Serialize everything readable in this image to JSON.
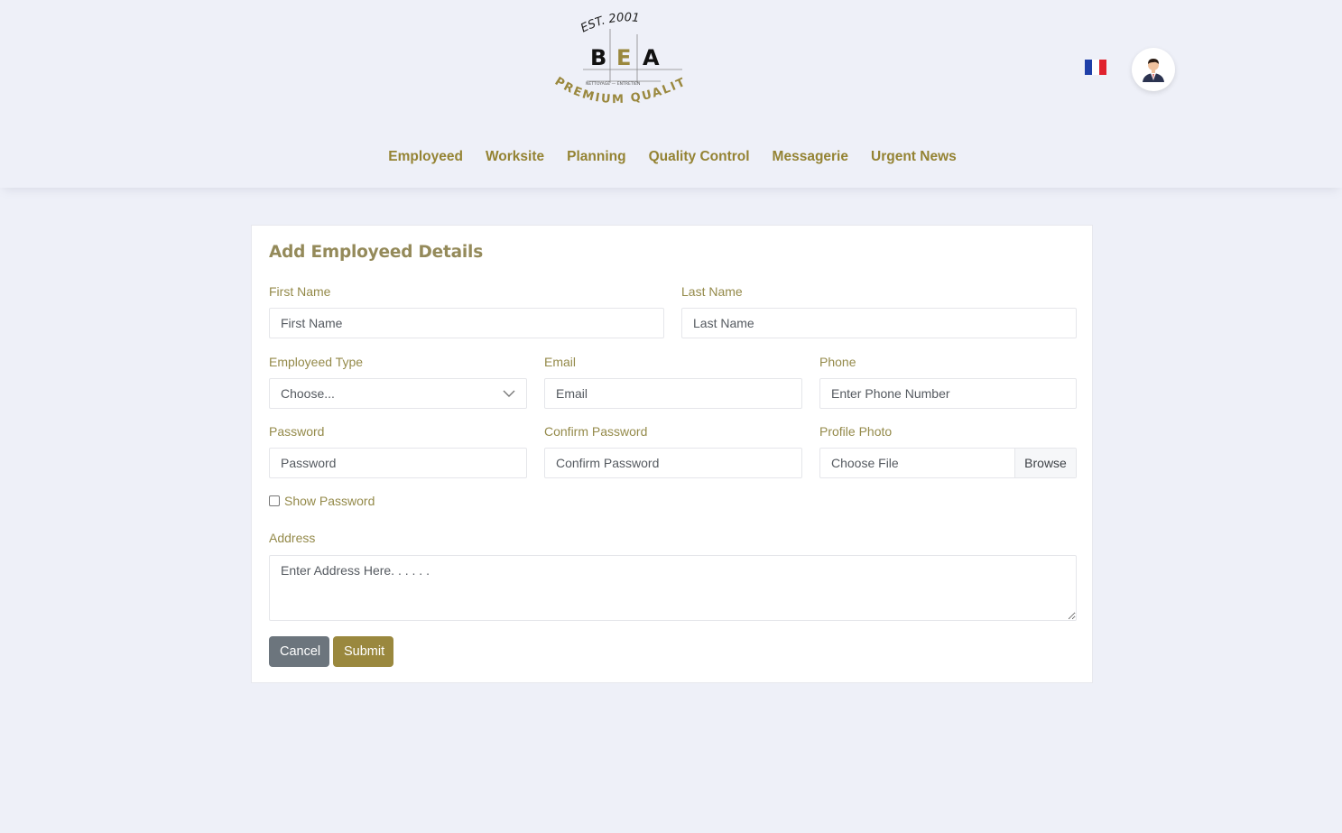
{
  "logo": {
    "est": "EST. 2001",
    "letters": [
      "B",
      "E",
      "A"
    ],
    "subtitle": "NETTOYAGE — ENTRETIEN",
    "tagline": "PREMIUM QUALITY"
  },
  "nav": {
    "items": [
      "Employeed",
      "Worksite",
      "Planning",
      "Quality Control",
      "Messagerie",
      "Urgent News"
    ]
  },
  "language": {
    "flag": "france-flag-icon"
  },
  "user": {
    "avatar": "user-avatar-icon"
  },
  "form": {
    "title": "Add Employeed Details",
    "first_name": {
      "label": "First Name",
      "placeholder": "First Name"
    },
    "last_name": {
      "label": "Last Name",
      "placeholder": "Last Name"
    },
    "employeed_type": {
      "label": "Employeed Type",
      "value": "Choose..."
    },
    "email": {
      "label": "Email",
      "placeholder": "Email"
    },
    "phone": {
      "label": "Phone",
      "placeholder": "Enter Phone Number"
    },
    "password": {
      "label": "Password",
      "placeholder": "Password"
    },
    "confirm_password": {
      "label": "Confirm Password",
      "placeholder": "Confirm Password"
    },
    "profile_photo": {
      "label": "Profile Photo",
      "value": "Choose File",
      "browse": "Browse"
    },
    "show_password": "Show Password",
    "address": {
      "label": "Address",
      "placeholder": "Enter Address Here. . . . . ."
    },
    "cancel": "Cancel",
    "submit": "Submit"
  },
  "colors": {
    "accent": "#948333",
    "submit": "#9a883e",
    "cancel": "#6c757d",
    "background": "#eef0f8"
  }
}
